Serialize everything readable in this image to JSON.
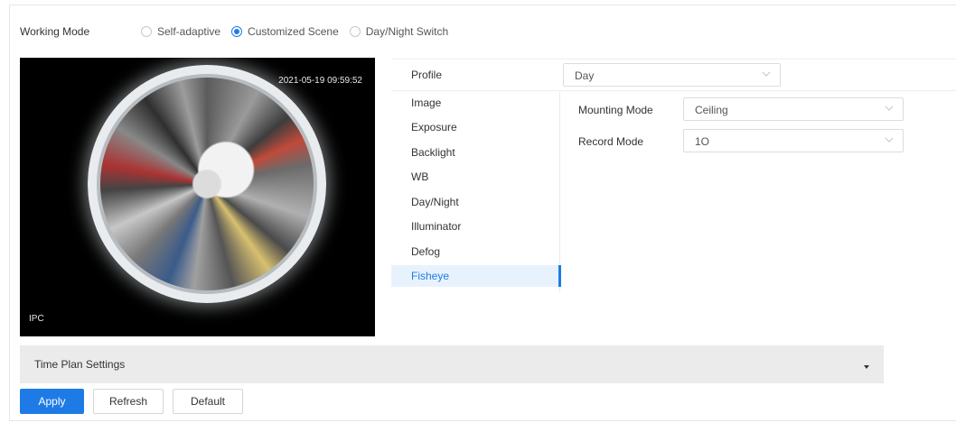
{
  "working_mode": {
    "label": "Working Mode",
    "options": [
      {
        "label": "Self-adaptive",
        "selected": false
      },
      {
        "label": "Customized Scene",
        "selected": true
      },
      {
        "label": "Day/Night Switch",
        "selected": false
      }
    ]
  },
  "video": {
    "timestamp": "2021-05-19 09:59:52",
    "channel": "IPC"
  },
  "profile": {
    "label": "Profile",
    "value": "Day"
  },
  "menu": {
    "items": [
      {
        "label": "Image",
        "active": false
      },
      {
        "label": "Exposure",
        "active": false
      },
      {
        "label": "Backlight",
        "active": false
      },
      {
        "label": "WB",
        "active": false
      },
      {
        "label": "Day/Night",
        "active": false
      },
      {
        "label": "Illuminator",
        "active": false
      },
      {
        "label": "Defog",
        "active": false
      },
      {
        "label": "Fisheye",
        "active": true
      }
    ]
  },
  "fisheye": {
    "mounting_mode_label": "Mounting Mode",
    "mounting_mode_value": "Ceiling",
    "record_mode_label": "Record Mode",
    "record_mode_value": "1O"
  },
  "time_plan": {
    "label": "Time Plan Settings"
  },
  "buttons": {
    "apply": "Apply",
    "refresh": "Refresh",
    "default": "Default"
  },
  "colors": {
    "accent": "#1e7be6",
    "bar_bg": "#ebebeb",
    "menu_active_bg": "#e8f2fd"
  }
}
